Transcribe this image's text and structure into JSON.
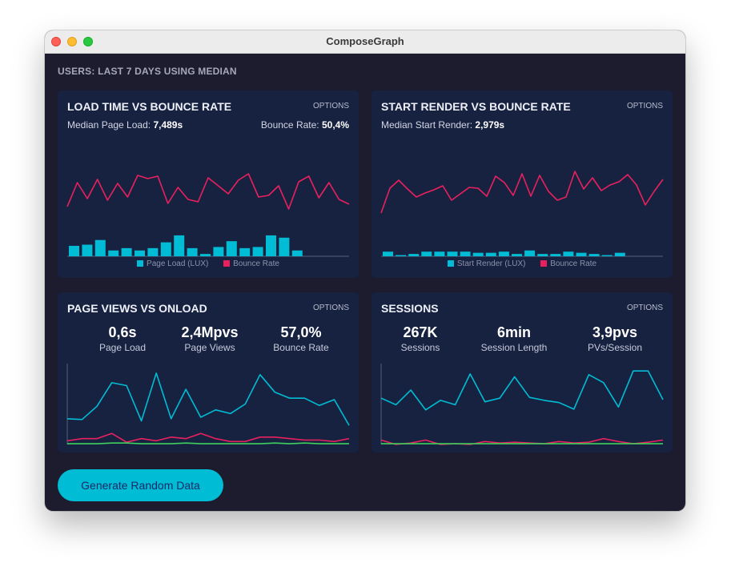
{
  "window": {
    "title": "ComposeGraph"
  },
  "heading": "USERS: LAST 7 DAYS USING MEDIAN",
  "colors": {
    "accent": "#00bcd4",
    "bounce": "#e8215e",
    "onload": "#3ed05c",
    "card": "#172241",
    "bg": "#1c1c2e"
  },
  "cards": {
    "load": {
      "title": "LOAD TIME VS BOUNCE RATE",
      "options": "OPTIONS",
      "metric_label": "Median Page Load:",
      "metric_value": "7,489s",
      "bounce_label": "Bounce Rate:",
      "bounce_value": "50,4%",
      "legend": [
        "Page Load (LUX)",
        "Bounce Rate"
      ]
    },
    "render": {
      "title": "START RENDER VS BOUNCE RATE",
      "options": "OPTIONS",
      "metric_label": "Median Start Render:",
      "metric_value": "2,979s",
      "legend": [
        "Start Render (LUX)",
        "Bounce Rate"
      ]
    },
    "pageviews": {
      "title": "PAGE VIEWS VS ONLOAD",
      "options": "OPTIONS",
      "stats": [
        {
          "value": "0,6s",
          "label": "Page Load"
        },
        {
          "value": "2,4Mpvs",
          "label": "Page Views"
        },
        {
          "value": "57,0%",
          "label": "Bounce Rate"
        }
      ]
    },
    "sessions": {
      "title": "SESSIONS",
      "options": "OPTIONS",
      "stats": [
        {
          "value": "267K",
          "label": "Sessions"
        },
        {
          "value": "6min",
          "label": "Session Length"
        },
        {
          "value": "3,9pvs",
          "label": "PVs/Session"
        }
      ]
    }
  },
  "button": {
    "label": "Generate Random Data"
  },
  "chart_data": [
    {
      "type": "bar",
      "id": "load",
      "series": [
        {
          "kind": "line",
          "color": "#e8215e",
          "values": [
            60,
            90,
            70,
            94,
            68,
            89,
            72,
            99,
            95,
            98,
            64,
            84,
            69,
            66,
            96,
            86,
            76,
            93,
            101,
            72,
            74,
            86,
            57,
            91,
            98,
            71,
            90,
            69,
            63
          ]
        },
        {
          "kind": "bar",
          "color": "#00bcd4",
          "values": [
            9,
            10,
            14,
            5,
            7,
            5,
            7,
            12,
            18,
            7,
            2,
            8,
            13,
            7,
            8,
            18,
            16,
            5
          ]
        }
      ]
    },
    {
      "type": "bar",
      "id": "render",
      "series": [
        {
          "kind": "line",
          "color": "#e8215e",
          "values": [
            52,
            83,
            93,
            82,
            72,
            77,
            81,
            86,
            68,
            76,
            84,
            83,
            73,
            98,
            90,
            74,
            101,
            73,
            99,
            79,
            68,
            72,
            104,
            82,
            96,
            80,
            87,
            91,
            100,
            87,
            62,
            79,
            94
          ]
        },
        {
          "kind": "bar",
          "color": "#00bcd4",
          "values": [
            4,
            1,
            2,
            4,
            4,
            4,
            4,
            3,
            3,
            4,
            2,
            5,
            2,
            2,
            4,
            3,
            2,
            1,
            3
          ]
        }
      ]
    },
    {
      "type": "line",
      "id": "pageviews",
      "series": [
        {
          "color": "#00bcd4",
          "values": [
            35,
            34,
            52,
            84,
            80,
            32,
            97,
            35,
            75,
            37,
            47,
            42,
            55,
            95,
            71,
            63,
            63,
            53,
            61,
            26
          ]
        },
        {
          "color": "#e8215e",
          "values": [
            5,
            8,
            8,
            15,
            3,
            8,
            5,
            10,
            8,
            15,
            8,
            4,
            4,
            10,
            10,
            8,
            6,
            6,
            4,
            8
          ]
        },
        {
          "color": "#3ed05c",
          "values": [
            1,
            1,
            1,
            2,
            2,
            1,
            1,
            1,
            2,
            1,
            1,
            1,
            1,
            1,
            2,
            1,
            2,
            1,
            1,
            1
          ]
        }
      ]
    },
    {
      "type": "line",
      "id": "sessions",
      "series": [
        {
          "color": "#00bcd4",
          "values": [
            63,
            54,
            74,
            47,
            60,
            54,
            96,
            58,
            63,
            92,
            64,
            60,
            57,
            48,
            95,
            84,
            51,
            100,
            100,
            61
          ]
        },
        {
          "color": "#e8215e",
          "values": [
            6,
            0,
            2,
            6,
            0,
            1,
            0,
            4,
            2,
            3,
            2,
            1,
            4,
            2,
            3,
            8,
            4,
            1,
            3,
            6
          ]
        },
        {
          "color": "#3ed05c",
          "values": [
            1,
            1,
            1,
            1,
            1,
            1,
            1,
            1,
            1,
            1,
            1,
            1,
            1,
            1,
            1,
            1,
            1,
            1,
            1,
            1
          ]
        }
      ]
    }
  ]
}
